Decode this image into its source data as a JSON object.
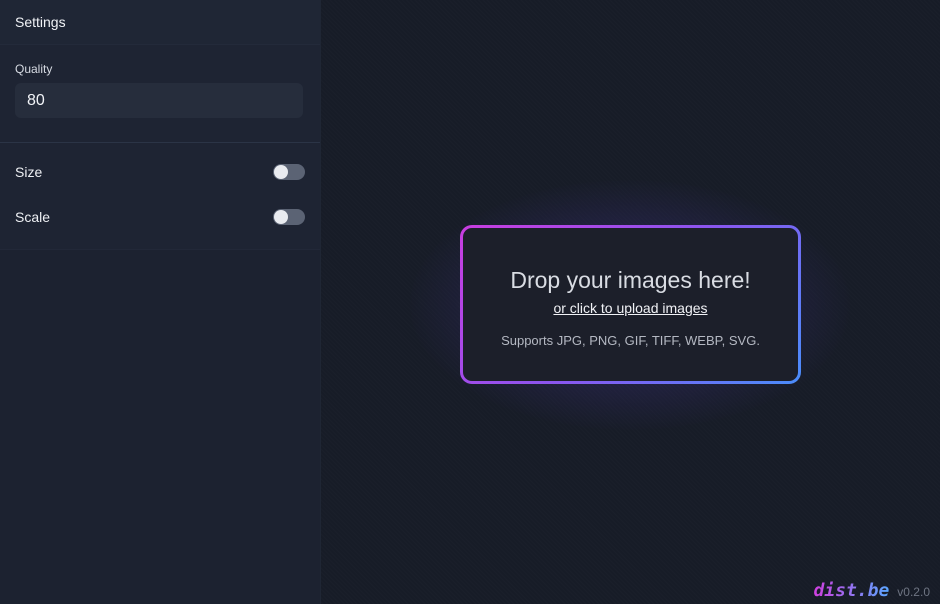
{
  "sidebar": {
    "title": "Settings",
    "quality": {
      "label": "Quality",
      "value": "80"
    },
    "toggles": [
      {
        "label": "Size",
        "enabled": false
      },
      {
        "label": "Scale",
        "enabled": false
      }
    ]
  },
  "dropzone": {
    "title": "Drop your images here!",
    "link": "or click to upload images",
    "formats": "Supports JPG, PNG, GIF, TIFF, WEBP, SVG."
  },
  "footer": {
    "logo": "dist.be",
    "version": "v0.2.0"
  },
  "colors": {
    "gradient_start": "#c93de0",
    "gradient_end": "#4a8dfb",
    "background": "#171c27",
    "sidebar": "#1c2230"
  }
}
